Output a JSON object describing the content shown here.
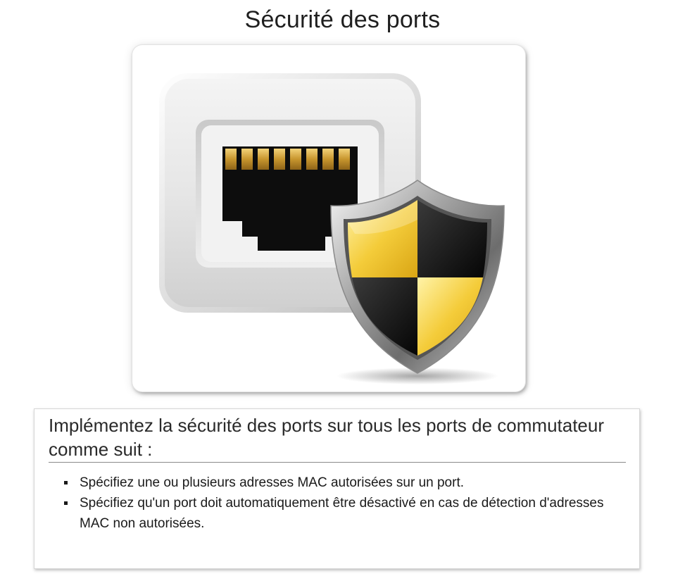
{
  "page": {
    "title": "Sécurité des ports"
  },
  "illustration": {
    "icon": "ethernet-port-shield-icon",
    "colors": {
      "shield_yellow": "#f4cc3a",
      "shield_black": "#111111",
      "port_black": "#0d0d0d",
      "pin_gold": "#d9a93a"
    }
  },
  "info": {
    "heading": "Implémentez la sécurité des ports sur tous les ports de commutateur comme suit :",
    "bullets": [
      "Spécifiez une ou plusieurs adresses MAC autorisées sur un port.",
      "Spécifiez qu'un port doit automatiquement être désactivé en cas de détection d'adresses MAC non autorisées."
    ]
  }
}
